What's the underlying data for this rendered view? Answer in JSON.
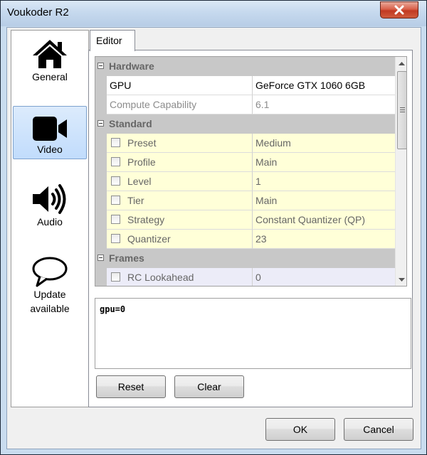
{
  "window": {
    "title": "Voukoder R2"
  },
  "nav": {
    "items": [
      {
        "label": "General",
        "icon": "home-icon",
        "active": false
      },
      {
        "label": "Video",
        "icon": "video-camera-icon",
        "active": true
      },
      {
        "label": "Audio",
        "icon": "speaker-icon",
        "active": false
      },
      {
        "label": "Update\navailable",
        "icon": "speech-bubble-icon",
        "active": false
      }
    ]
  },
  "tab": {
    "label": "Editor"
  },
  "grid": {
    "categories": {
      "hardware": "Hardware",
      "standard": "Standard",
      "frames": "Frames"
    },
    "rows": {
      "gpu": {
        "name": "GPU",
        "value": "GeForce GTX 1060 6GB"
      },
      "compute": {
        "name": "Compute Capability",
        "value": "6.1"
      },
      "preset": {
        "name": "Preset",
        "value": "Medium"
      },
      "profile": {
        "name": "Profile",
        "value": "Main"
      },
      "level": {
        "name": "Level",
        "value": "1"
      },
      "tier": {
        "name": "Tier",
        "value": "Main"
      },
      "strategy": {
        "name": "Strategy",
        "value": "Constant Quantizer (QP)"
      },
      "quantizer": {
        "name": "Quantizer",
        "value": "23"
      },
      "rc_lookahead": {
        "name": "RC Lookahead",
        "value": "0"
      }
    }
  },
  "params_text": "gpu=0",
  "buttons": {
    "reset": "Reset",
    "clear": "Clear",
    "ok": "OK",
    "cancel": "Cancel"
  },
  "colors": {
    "active_nav": "#c1dcfc",
    "property_yellow": "#ffffd8",
    "category_gray": "#c8c8c8",
    "close_red": "#c13a22"
  }
}
